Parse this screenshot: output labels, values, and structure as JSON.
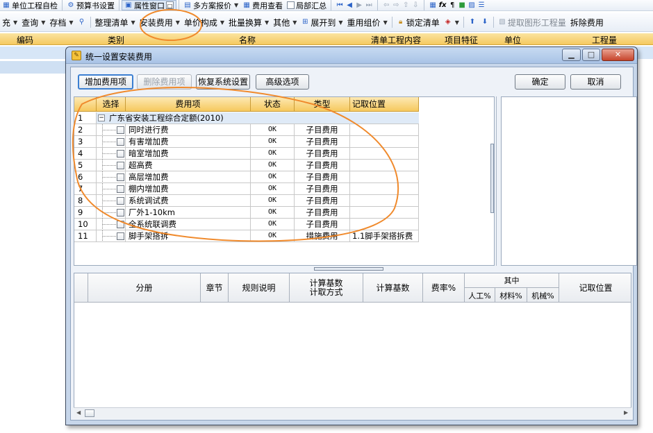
{
  "toolbar1": {
    "items": [
      "单位工程自检",
      "预算书设置",
      "属性窗口",
      "多方案报价",
      "费用查看",
      "局部汇总"
    ]
  },
  "toolbar2": {
    "items": [
      "充",
      "查询",
      "存档",
      "整理清单",
      "安装费用",
      "单价构成",
      "批量换算",
      "其他",
      "展开到",
      "重用组价",
      "锁定清单",
      "提取图形工程量",
      "拆除费用"
    ]
  },
  "main_header": {
    "columns": [
      "编码",
      "类别",
      "名称",
      "清单工程内容",
      "项目特征",
      "单位",
      "工程量"
    ]
  },
  "dialog": {
    "title": "统一设置安装费用",
    "buttons": {
      "add": "增加费用项",
      "delete": "删除费用项",
      "restore": "恢复系统设置",
      "advanced": "高级选项",
      "ok": "确定",
      "cancel": "取消"
    },
    "upper_grid": {
      "headers": [
        "选择",
        "费用项",
        "状态",
        "类型",
        "记取位置"
      ],
      "group": {
        "num": "1",
        "name": "广东省安装工程综合定额(2010)"
      },
      "rows": [
        {
          "num": "2",
          "name": "同时进行费",
          "status": "OK",
          "type": "子目费用",
          "loc": ""
        },
        {
          "num": "3",
          "name": "有害增加费",
          "status": "OK",
          "type": "子目费用",
          "loc": ""
        },
        {
          "num": "4",
          "name": "暗室增加费",
          "status": "OK",
          "type": "子目费用",
          "loc": ""
        },
        {
          "num": "5",
          "name": "超高费",
          "status": "OK",
          "type": "子目费用",
          "loc": ""
        },
        {
          "num": "6",
          "name": "高层增加费",
          "status": "OK",
          "type": "子目费用",
          "loc": ""
        },
        {
          "num": "7",
          "name": "棚内增加费",
          "status": "OK",
          "type": "子目费用",
          "loc": ""
        },
        {
          "num": "8",
          "name": "系统调试费",
          "status": "OK",
          "type": "子目费用",
          "loc": ""
        },
        {
          "num": "9",
          "name": "厂外1-10km",
          "status": "OK",
          "type": "子目费用",
          "loc": ""
        },
        {
          "num": "10",
          "name": "全系统联调费",
          "status": "OK",
          "type": "子目费用",
          "loc": ""
        },
        {
          "num": "11",
          "name": "脚手架搭拆",
          "status": "OK",
          "type": "措施费用",
          "loc": "1.1脚手架搭拆费"
        }
      ]
    },
    "lower_grid": {
      "fen_xiang": "分册",
      "zhang_jie": "章节",
      "gui_ze": "规则说明",
      "ji_suan_ji_shu_1": "计算基数",
      "ji_qu_fang_shi": "计取方式",
      "ji_suan_ji_shu": "计算基数",
      "fei_lv": "费率%",
      "qi_zhong": "其中",
      "ren_gong": "人工%",
      "cai_liao": "材料%",
      "ji_xie": "机械%",
      "ji_qu_wei_zhi": "记取位置"
    }
  },
  "colors": {
    "annotation": "#f08a2c",
    "grid_header": "#f6c95e"
  }
}
